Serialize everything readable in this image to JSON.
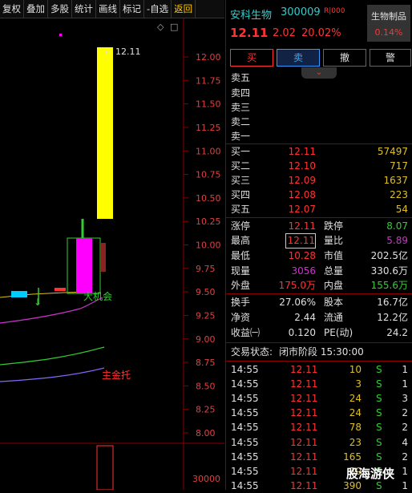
{
  "toolbar": {
    "items": [
      "复权",
      "叠加",
      "多股",
      "统计",
      "画线",
      "标记",
      "-自选",
      "返回"
    ]
  },
  "chart": {
    "y_ticks": [
      "12.00",
      "11.75",
      "11.50",
      "11.25",
      "11.00",
      "10.75",
      "10.50",
      "10.25",
      "10.00",
      "9.75",
      "9.50",
      "9.25",
      "9.00",
      "8.75",
      "8.50",
      "8.25",
      "8.00"
    ],
    "volume_tick": "30000",
    "high_marker": "12.11",
    "annot_opportunity": "大机会",
    "annot_fund": "主金托",
    "diamond": "◇",
    "icon_box": "□"
  },
  "chart_data": {
    "type": "candlestick",
    "ylim": [
      7.9,
      12.1
    ],
    "y_ticks": [
      12.0,
      11.75,
      11.5,
      11.25,
      11.0,
      10.75,
      10.5,
      10.25,
      10.0,
      9.75,
      9.5,
      9.25,
      9.0,
      8.75,
      8.5,
      8.25,
      8.0
    ],
    "last_candle": {
      "open": 10.28,
      "close": 12.11,
      "high": 12.11,
      "low": 10.28
    },
    "prev_candle": {
      "open": 9.53,
      "close": 10.09,
      "high": 10.39,
      "low": 9.53
    },
    "volume_axis_tick": 30000
  },
  "header": {
    "name": "安科生物",
    "code": "300009",
    "tag": "R|000",
    "sector": "生物制品",
    "sector_change": "0.14%",
    "price": "12.11",
    "change": "2.02",
    "change_pct": "20.02%"
  },
  "actions": {
    "buy": "买",
    "sell": "卖",
    "cancel": "撤",
    "alert": "警"
  },
  "sell_orders": [
    {
      "label": "卖五",
      "price": "",
      "vol": ""
    },
    {
      "label": "卖四",
      "price": "",
      "vol": ""
    },
    {
      "label": "卖三",
      "price": "",
      "vol": ""
    },
    {
      "label": "卖二",
      "price": "",
      "vol": ""
    },
    {
      "label": "卖一",
      "price": "",
      "vol": ""
    }
  ],
  "buy_orders": [
    {
      "label": "买一",
      "price": "12.11",
      "vol": "57497"
    },
    {
      "label": "买二",
      "price": "12.10",
      "vol": "717"
    },
    {
      "label": "买三",
      "price": "12.09",
      "vol": "1637"
    },
    {
      "label": "买四",
      "price": "12.08",
      "vol": "223"
    },
    {
      "label": "买五",
      "price": "12.07",
      "vol": "54"
    }
  ],
  "stats": {
    "limit_up_label": "涨停",
    "limit_up": "12.11",
    "limit_down_label": "跌停",
    "limit_down": "8.07",
    "high_label": "最高",
    "high": "12.11",
    "vol_ratio_label": "量比",
    "vol_ratio": "5.89",
    "low_label": "最低",
    "low": "10.28",
    "mkt_cap_label": "市值",
    "mkt_cap": "202.5亿",
    "cur_vol_label": "现量",
    "cur_vol": "3056",
    "total_vol_label": "总量",
    "total_vol": "330.6万",
    "outer_label": "外盘",
    "outer": "175.0万",
    "inner_label": "内盘",
    "inner": "155.6万",
    "turnover_label": "换手",
    "turnover": "27.06%",
    "shares_label": "股本",
    "shares": "16.7亿",
    "nav_label": "净资",
    "nav": "2.44",
    "float_label": "流通",
    "float": "12.2亿",
    "eps_label": "收益㈠",
    "eps": "0.120",
    "pe_label": "PE(动)",
    "pe": "24.2"
  },
  "status": {
    "label": "交易状态:",
    "value": "闭市阶段 15:30:00"
  },
  "trades": [
    {
      "time": "14:55",
      "price": "12.11",
      "vol": "10",
      "side": "S",
      "n": "1"
    },
    {
      "time": "14:55",
      "price": "12.11",
      "vol": "3",
      "side": "S",
      "n": "1"
    },
    {
      "time": "14:55",
      "price": "12.11",
      "vol": "24",
      "side": "S",
      "n": "3"
    },
    {
      "time": "14:55",
      "price": "12.11",
      "vol": "24",
      "side": "S",
      "n": "2"
    },
    {
      "time": "14:55",
      "price": "12.11",
      "vol": "78",
      "side": "S",
      "n": "2"
    },
    {
      "time": "14:55",
      "price": "12.11",
      "vol": "23",
      "side": "S",
      "n": "4"
    },
    {
      "time": "14:55",
      "price": "12.11",
      "vol": "165",
      "side": "S",
      "n": "2"
    },
    {
      "time": "14:55",
      "price": "12.11",
      "vol": "30",
      "side": "S",
      "n": "1"
    },
    {
      "time": "14:55",
      "price": "12.11",
      "vol": "390",
      "side": "S",
      "n": "1"
    }
  ],
  "watermark": "股海游侠",
  "colors": {
    "up": "#ff3333",
    "down": "#33cc33",
    "limit_candle": "#ffff00",
    "candle_body": "#ff00ff",
    "axis": "#8b0000"
  }
}
